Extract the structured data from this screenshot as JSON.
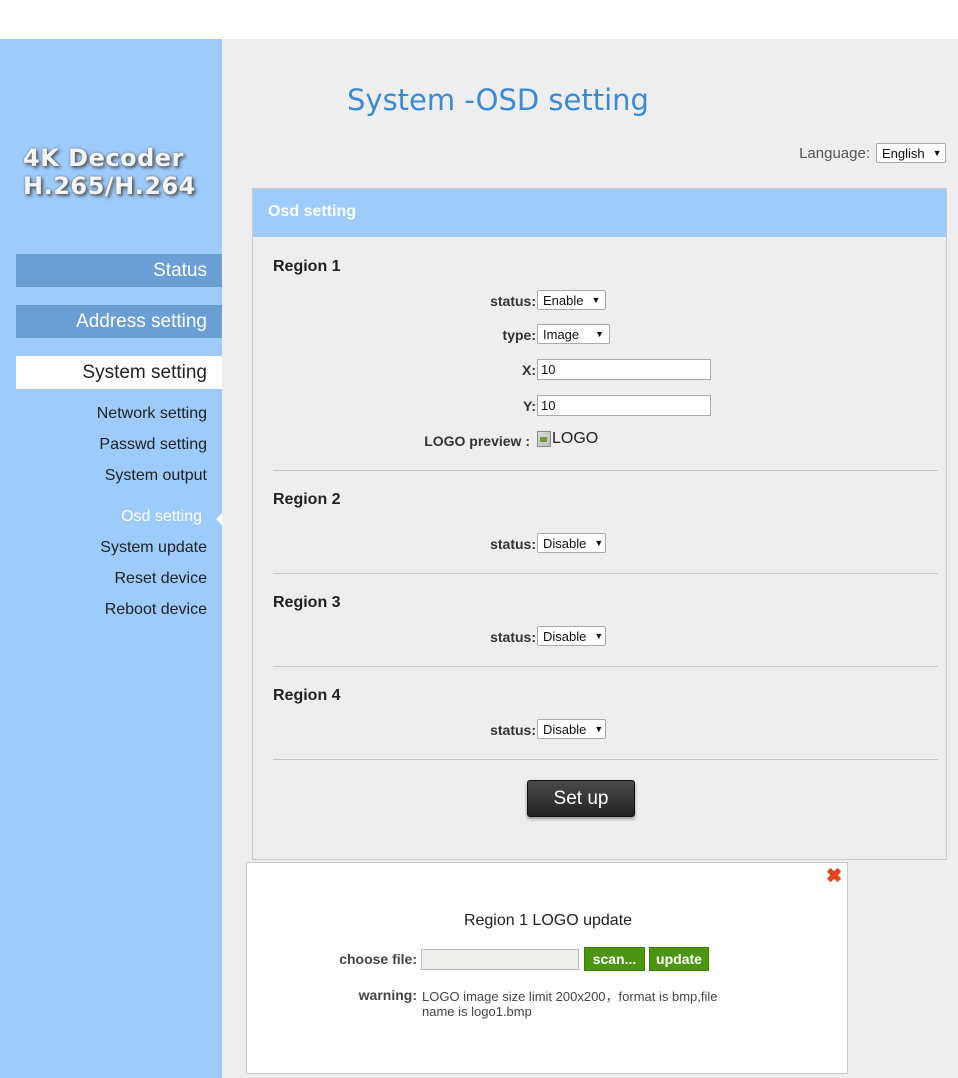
{
  "sidebar": {
    "logo_line1": "4K Decoder",
    "logo_line2": "H.265/H.264",
    "main_items": [
      {
        "label": "Status"
      },
      {
        "label": "Address setting"
      },
      {
        "label": "System setting"
      }
    ],
    "sub_items": [
      {
        "label": "Network setting"
      },
      {
        "label": "Passwd setting"
      },
      {
        "label": "System output"
      },
      {
        "label": "Osd setting"
      },
      {
        "label": "System update"
      },
      {
        "label": "Reset device"
      },
      {
        "label": "Reboot device"
      }
    ]
  },
  "header": {
    "title": "System -OSD setting",
    "language_label": "Language:",
    "language_value": "English"
  },
  "panel": {
    "title": "Osd setting",
    "regions": [
      {
        "title": "Region 1",
        "status_label": "status:",
        "status_value": "Enable",
        "type_label": "type:",
        "type_value": "Image",
        "x_label": "X:",
        "x_value": "10",
        "y_label": "Y:",
        "y_value": "10",
        "preview_label": "LOGO preview :",
        "preview_alt": "LOGO"
      },
      {
        "title": "Region 2",
        "status_label": "status:",
        "status_value": "Disable"
      },
      {
        "title": "Region 3",
        "status_label": "status:",
        "status_value": "Disable"
      },
      {
        "title": "Region 4",
        "status_label": "status:",
        "status_value": "Disable"
      }
    ],
    "setup_label": "Set up"
  },
  "dialog": {
    "title": "Region 1 LOGO update",
    "choose_label": "choose file:",
    "scan_label": "scan...",
    "update_label": "update",
    "warning_label": "warning:",
    "warning_text": "LOGO image size limit 200x200，format is bmp,file name is logo1.bmp",
    "close_glyph": "✖"
  },
  "colors": {
    "sidebar_bg": "#9ccbfc",
    "nav_item_bg": "#6a9fd4",
    "title_blue": "#3a8ad4",
    "green_button": "#4b9511",
    "close_red": "#e8431c"
  }
}
